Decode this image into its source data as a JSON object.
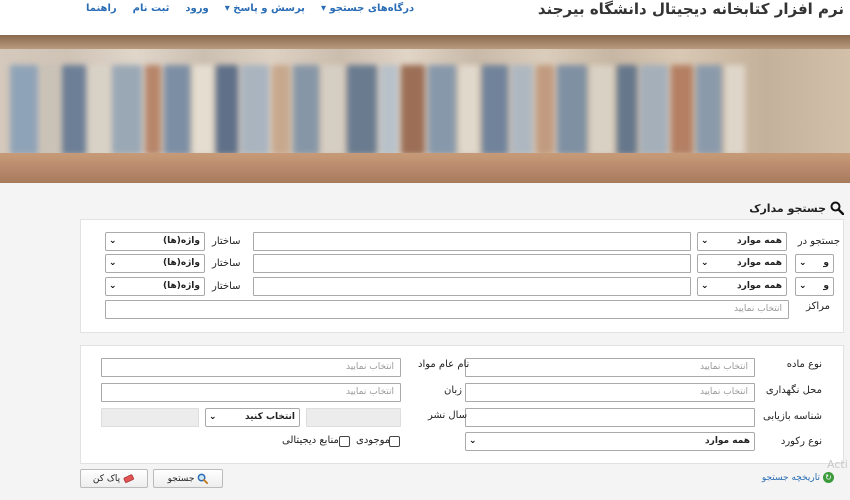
{
  "header": {
    "title": "نرم افزار کتابخانه دیجیتال دانشگاه بیرجند",
    "nav": [
      "درگاه‌های جستجو ▾",
      "پرسش و پاسخ ▾",
      "ورود",
      "ثبت نام",
      "راهنما"
    ]
  },
  "section_title": "جستجو مدارک",
  "search_rows": [
    {
      "label": "جستجو در",
      "op": "",
      "field": "همه موارد",
      "structure_label": "ساختار",
      "structure": "واژه(ها)"
    },
    {
      "label": "",
      "op": "و",
      "field": "همه موارد",
      "structure_label": "ساختار",
      "structure": "واژه(ها)"
    },
    {
      "label": "",
      "op": "و",
      "field": "همه موارد",
      "structure_label": "ساختار",
      "structure": "واژه(ها)"
    }
  ],
  "centers": {
    "label": "مراکز",
    "placeholder": "انتخاب نمایید"
  },
  "filters": {
    "material_type": {
      "label": "نوع ماده",
      "placeholder": "انتخاب نمایید"
    },
    "general_material": {
      "label": "نام عام مواد",
      "placeholder": "انتخاب نمایید"
    },
    "location": {
      "label": "محل نگهداری",
      "placeholder": "انتخاب نمایید"
    },
    "language": {
      "label": "زبان",
      "placeholder": "انتخاب نمایید"
    },
    "call_number": {
      "label": "شناسه بازیابی"
    },
    "pub_year": {
      "label": "سال نشر",
      "select": "انتخاب کنید"
    },
    "record_type": {
      "label": "نوع رکورد",
      "value": "همه موارد"
    },
    "available": "موجودی",
    "digital": "منابع دیجیتالی"
  },
  "buttons": {
    "search": "جستجو",
    "clear": "پاک کن"
  },
  "history_link": "تاریخچه جستجو",
  "watermark": "Acti",
  "colors": {
    "link": "#2a6db5",
    "history_icon": "#3b9b3b"
  }
}
